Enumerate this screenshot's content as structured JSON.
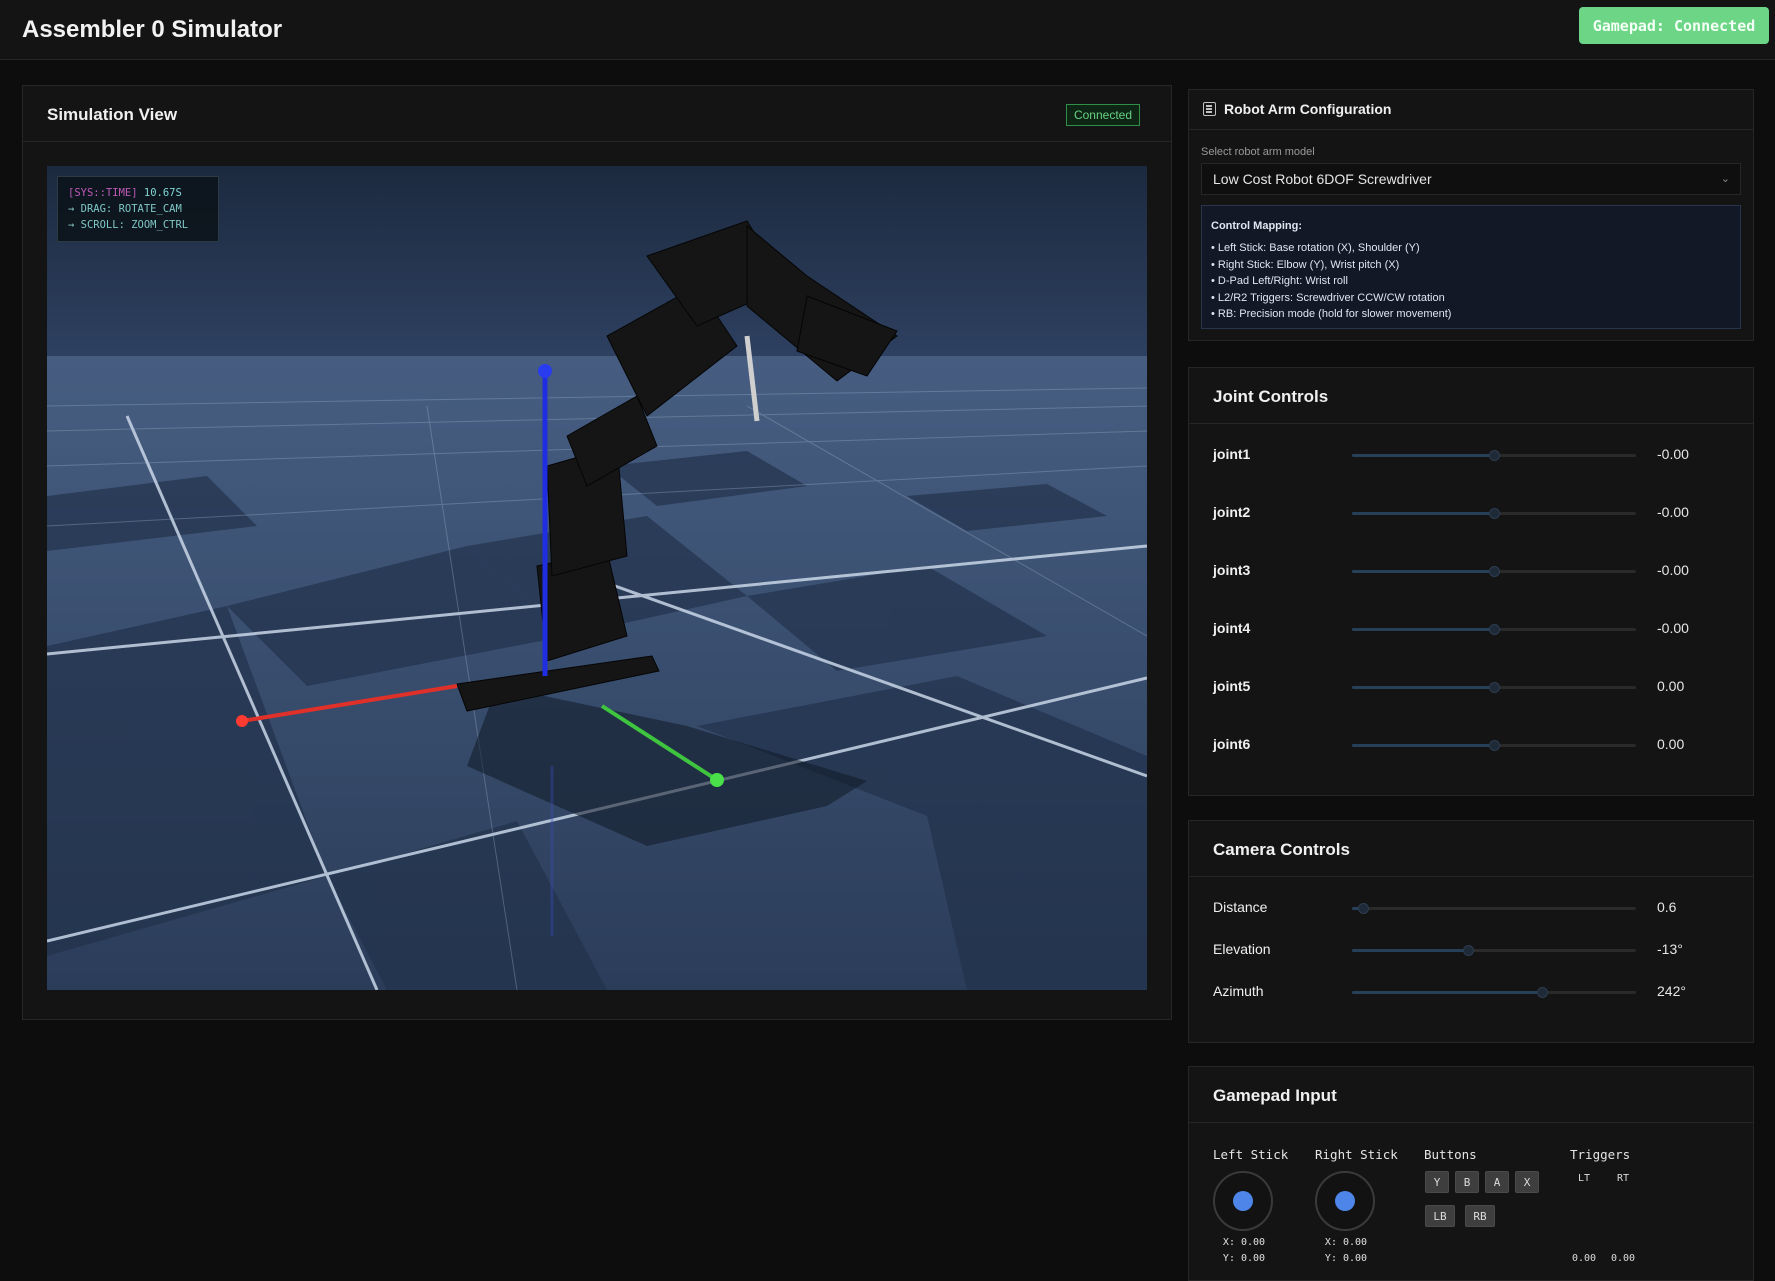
{
  "app": {
    "title": "Assembler 0 Simulator",
    "gamepad_status": "Gamepad: Connected"
  },
  "simulation": {
    "title": "Simulation View",
    "status": "Connected",
    "hud": {
      "time_key": "[SYS::TIME]",
      "time_value": "10.67S",
      "drag_hint": "→ DRAG: ROTATE_CAM",
      "scroll_hint": "→ SCROLL: ZOOM_CTRL"
    }
  },
  "config": {
    "title": "Robot Arm Configuration",
    "select_label": "Select robot arm model",
    "selected_model": "Low Cost Robot 6DOF Screwdriver",
    "mapping_title": "Control Mapping:",
    "mapping": [
      "• Left Stick: Base rotation (X), Shoulder (Y)",
      "• Right Stick: Elbow (Y), Wrist pitch (X)",
      "• D-Pad Left/Right: Wrist roll",
      "• L2/R2 Triggers: Screwdriver CCW/CW rotation",
      "• RB: Precision mode (hold for slower movement)"
    ]
  },
  "joints": {
    "title": "Joint Controls",
    "items": [
      {
        "label": "joint1",
        "value": "-0.00",
        "level": 0.5
      },
      {
        "label": "joint2",
        "value": "-0.00",
        "level": 0.5
      },
      {
        "label": "joint3",
        "value": "-0.00",
        "level": 0.5
      },
      {
        "label": "joint4",
        "value": "-0.00",
        "level": 0.5
      },
      {
        "label": "joint5",
        "value": "0.00",
        "level": 0.5
      },
      {
        "label": "joint6",
        "value": "0.00",
        "level": 0.5
      }
    ]
  },
  "camera": {
    "title": "Camera Controls",
    "items": [
      {
        "label": "Distance",
        "value": "0.6",
        "level": 0.04
      },
      {
        "label": "Elevation",
        "value": "-13°",
        "level": 0.41
      },
      {
        "label": "Azimuth",
        "value": "242°",
        "level": 0.67
      }
    ]
  },
  "gamepad": {
    "title": "Gamepad Input",
    "left_stick": {
      "label": "Left Stick",
      "x": "X: 0.00",
      "y": "Y: 0.00"
    },
    "right_stick": {
      "label": "Right Stick",
      "x": "X: 0.00",
      "y": "Y: 0.00"
    },
    "buttons_label": "Buttons",
    "buttons": [
      "Y",
      "B",
      "A",
      "X",
      "LB",
      "RB"
    ],
    "triggers_label": "Triggers",
    "lt_label": "LT",
    "rt_label": "RT",
    "lt_value": "0.00",
    "rt_value": "0.00"
  },
  "colors": {
    "accent_green": "#6cd686",
    "stick_dot": "#4d86e8",
    "axis_x": "#e0302a",
    "axis_y": "#3fc43f",
    "axis_z": "#1f2ee0"
  }
}
